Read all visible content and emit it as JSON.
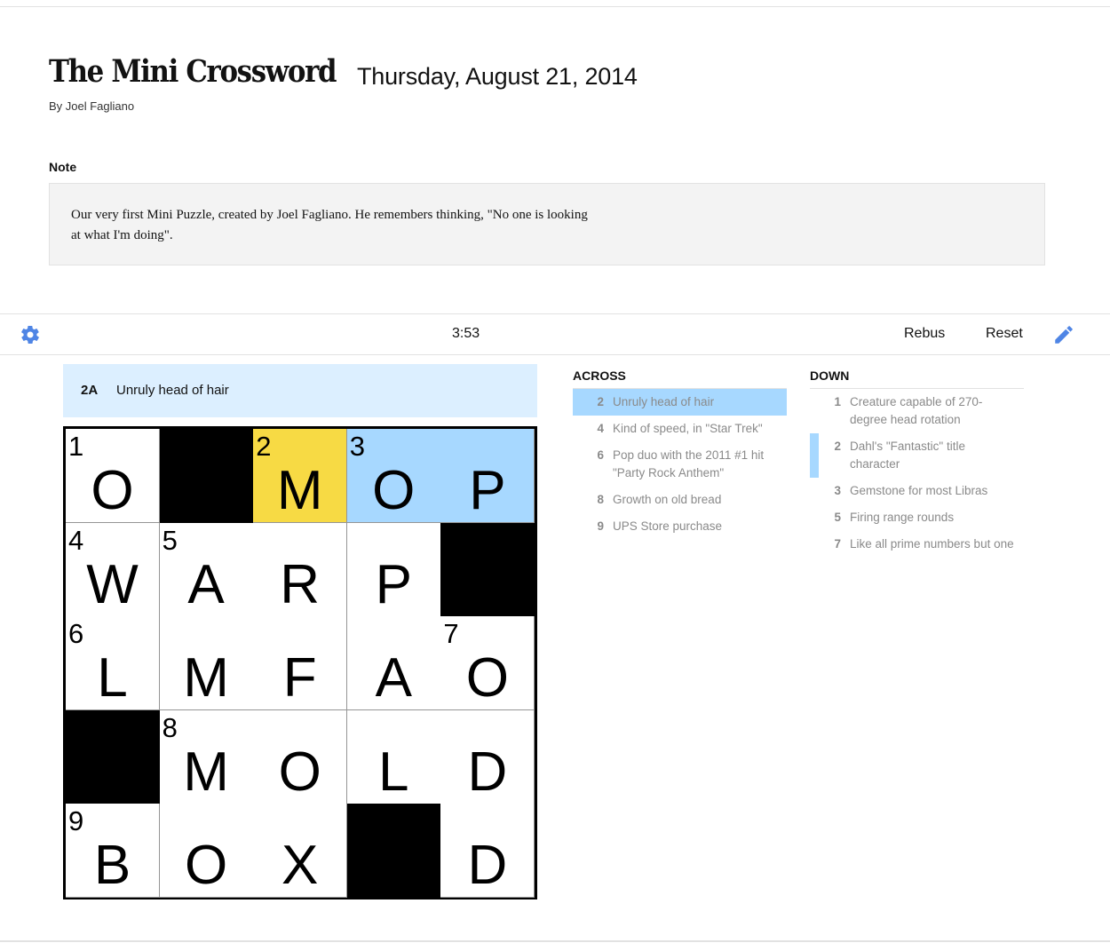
{
  "header": {
    "title": "The Mini Crossword",
    "date": "Thursday, August 21, 2014",
    "byline": "By Joel Fagliano"
  },
  "note": {
    "label": "Note",
    "text": "Our very first Mini Puzzle, created by Joel Fagliano. He remembers thinking, \"No one is looking at what I'm doing\"."
  },
  "toolbar": {
    "settings_icon": "gear-icon",
    "timer": "3:53",
    "rebus_label": "Rebus",
    "reset_label": "Reset",
    "pencil_icon": "pencil-icon"
  },
  "current_clue": {
    "number": "2A",
    "text": "Unruly head of hair"
  },
  "colors": {
    "accent": "#4f85e5",
    "selected_cell": "#f7da44",
    "word_highlight": "#a7d8ff",
    "clue_bar": "#dcefff"
  },
  "grid": {
    "rows": 5,
    "cols": 5,
    "cells": [
      [
        {
          "num": "1",
          "letter": "O"
        },
        {
          "black": true
        },
        {
          "num": "2",
          "letter": "M",
          "state": "selected"
        },
        {
          "num": "3",
          "letter": "O",
          "state": "word"
        },
        {
          "letter": "P",
          "state": "word"
        }
      ],
      [
        {
          "num": "4",
          "letter": "W"
        },
        {
          "num": "5",
          "letter": "A"
        },
        {
          "letter": "R"
        },
        {
          "letter": "P"
        },
        {
          "black": true
        }
      ],
      [
        {
          "num": "6",
          "letter": "L"
        },
        {
          "letter": "M"
        },
        {
          "letter": "F"
        },
        {
          "letter": "A"
        },
        {
          "num": "7",
          "letter": "O"
        }
      ],
      [
        {
          "black": true
        },
        {
          "num": "8",
          "letter": "M"
        },
        {
          "letter": "O"
        },
        {
          "letter": "L"
        },
        {
          "letter": "D"
        }
      ],
      [
        {
          "num": "9",
          "letter": "B"
        },
        {
          "letter": "O"
        },
        {
          "letter": "X"
        },
        {
          "black": true
        },
        {
          "letter": "D"
        }
      ]
    ]
  },
  "across": {
    "title": "ACROSS",
    "clues": [
      {
        "num": "2",
        "text": "Unruly head of hair",
        "state": "active"
      },
      {
        "num": "4",
        "text": "Kind of speed, in \"Star Trek\""
      },
      {
        "num": "6",
        "text": "Pop duo with the 2011 #1 hit \"Party Rock Anthem\""
      },
      {
        "num": "8",
        "text": "Growth on old bread"
      },
      {
        "num": "9",
        "text": "UPS Store purchase"
      }
    ]
  },
  "down": {
    "title": "DOWN",
    "clues": [
      {
        "num": "1",
        "text": "Creature capable of 270-degree head rotation"
      },
      {
        "num": "2",
        "text": "Dahl's \"Fantastic\" title character",
        "state": "cross-ref"
      },
      {
        "num": "3",
        "text": "Gemstone for most Libras"
      },
      {
        "num": "5",
        "text": "Firing range rounds"
      },
      {
        "num": "7",
        "text": "Like all prime numbers but one"
      }
    ]
  }
}
